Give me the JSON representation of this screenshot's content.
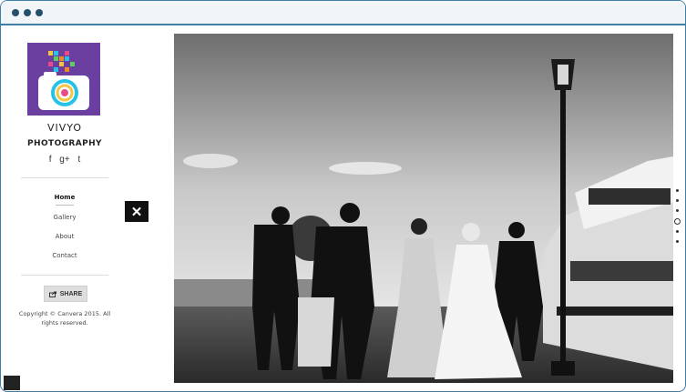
{
  "window": {
    "controls": [
      "close",
      "minimize",
      "maximize"
    ]
  },
  "brand": {
    "name": "VIVYO",
    "tagline": "PHOTOGRAPHY"
  },
  "social": [
    {
      "icon": "facebook-icon",
      "glyph": "f"
    },
    {
      "icon": "google-plus-icon",
      "glyph": "g+"
    },
    {
      "icon": "twitter-icon",
      "glyph": "t"
    }
  ],
  "nav": {
    "items": [
      {
        "label": "Home",
        "active": true
      },
      {
        "label": "Gallery",
        "active": false
      },
      {
        "label": "About",
        "active": false
      },
      {
        "label": "Contact",
        "active": false
      }
    ]
  },
  "share": {
    "label": "SHARE",
    "icon": "share-icon"
  },
  "footer": {
    "copyright": "Copyright © Canvera 2015. All rights reserved."
  },
  "close_button": {
    "icon": "close-icon",
    "glyph": "✕"
  },
  "gallery": {
    "image": "black-and-white wedding party walking on a pier beside a yacht",
    "slide_count": 6,
    "active_slide": 3
  },
  "colors": {
    "frame": "#3f7fa6",
    "titlebar_dots": "#24506e",
    "logo_bg": "#6a3fa0"
  }
}
